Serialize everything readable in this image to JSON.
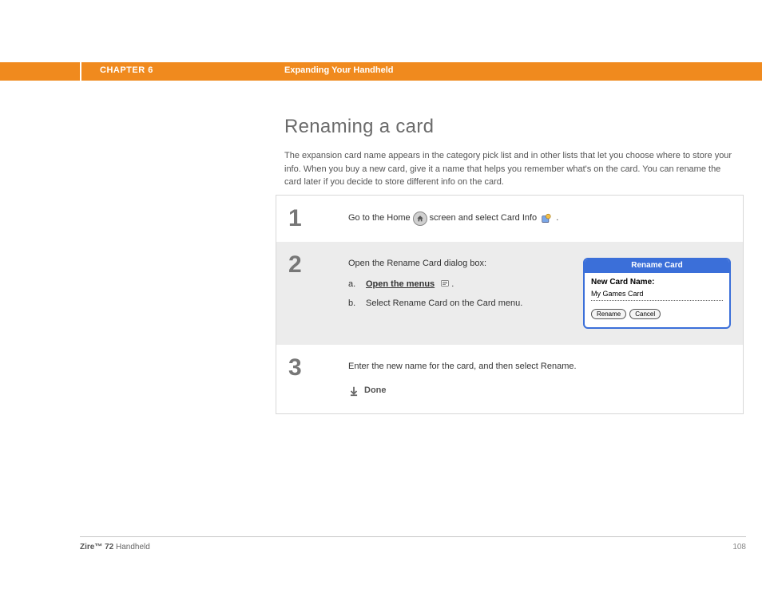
{
  "header": {
    "chapter": "CHAPTER 6",
    "section": "Expanding Your Handheld"
  },
  "main": {
    "title": "Renaming a card",
    "intro": "The expansion card name appears in the category pick list and in other lists that let you choose where to store your info. When you buy a new card, give it a name that helps you remember what's on the card. You can rename the card later if you decide to store different info on the card."
  },
  "steps": [
    {
      "num": "1",
      "text_before": "Go to the Home",
      "text_mid": "screen and select Card Info",
      "text_after": "."
    },
    {
      "num": "2",
      "lead": "Open the Rename Card dialog box:",
      "sub_a_letter": "a.",
      "sub_a_link": "Open the menus",
      "sub_a_after": ".",
      "sub_b_letter": "b.",
      "sub_b_text": "Select Rename Card on the Card menu.",
      "dialog": {
        "title": "Rename Card",
        "label": "New Card Name:",
        "value": "My Games Card",
        "btn_rename": "Rename",
        "btn_cancel": "Cancel"
      }
    },
    {
      "num": "3",
      "text": "Enter the new name for the card, and then select Rename.",
      "done": "Done"
    }
  ],
  "footer": {
    "device_bold": "Zire™ 72",
    "device_rest": " Handheld",
    "page": "108"
  }
}
